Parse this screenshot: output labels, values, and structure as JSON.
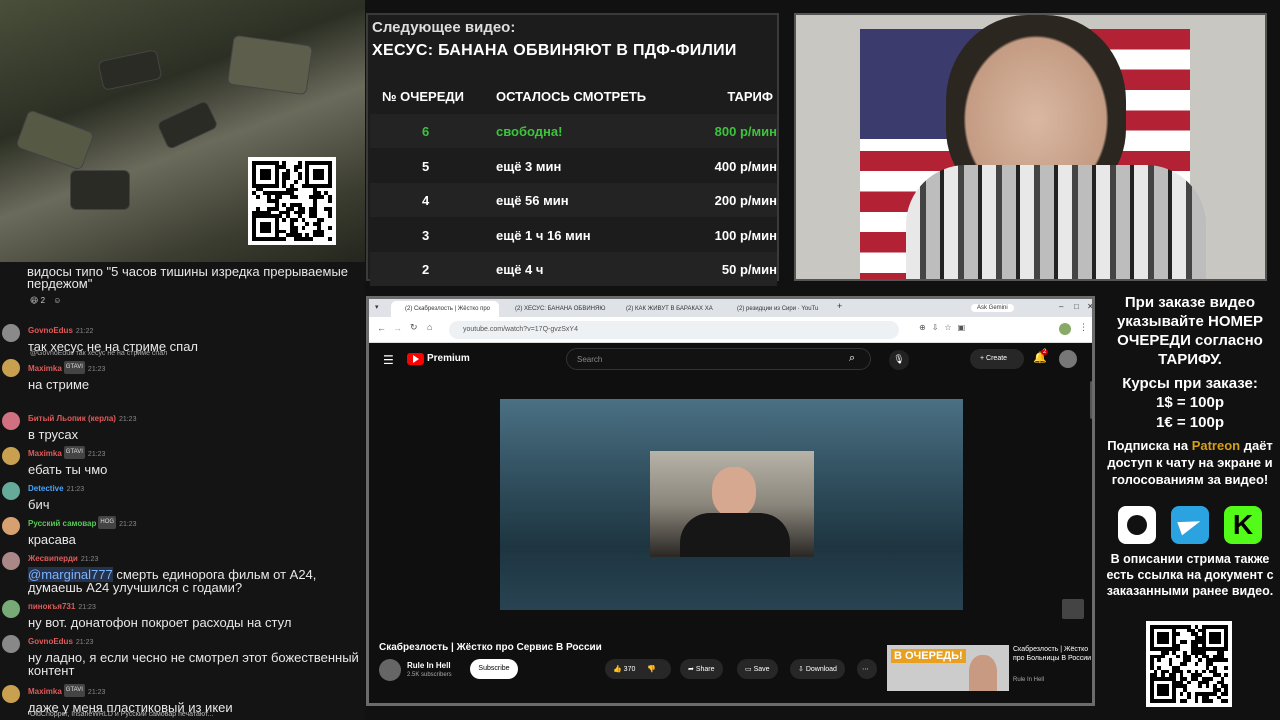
{
  "chat": {
    "top_text": "видосы типо \"5 часов тишины изредка прерываемые пердежом\"",
    "top_reactions": "2",
    "messages": [
      {
        "user": "GovnoEdus",
        "time": "21:22",
        "text": "так хесус не на стриме спал",
        "color": "#e05a5a"
      },
      {
        "reply": "@GovnoEdus так хесус не на стриме спал",
        "user": "Maximka",
        "badge": "GTAVI",
        "time": "21:23",
        "text": "на стриме",
        "color": "#e05a5a"
      },
      {
        "user": "Битый Льопик (керла)",
        "time": "21:23",
        "text": "в трусах",
        "color": "#e05a5a"
      },
      {
        "user": "Maximka",
        "badge": "GTAVI",
        "time": "21:23",
        "text": "ебать ты чмо",
        "color": "#e05a5a"
      },
      {
        "user": "Detective",
        "time": "21:23",
        "text": "бич",
        "color": "#4aa3ff"
      },
      {
        "user": "Русский самовар",
        "badge": "HOG",
        "time": "21:23",
        "text": "красава",
        "color": "#57c857"
      },
      {
        "user": "Жесвиперди",
        "time": "21:23",
        "mention": "@marginal777",
        "text": " смерть единорога фильм от A24, думаешь A24 улучшился с годами?",
        "color": "#e05a5a"
      },
      {
        "user": "пинокъя731",
        "time": "21:23",
        "text": "ну вот. донатофон покроет расходы на стул",
        "color": "#e05a5a"
      },
      {
        "user": "GovnoEdus",
        "time": "21:23",
        "text": "ну ладно, я если чесно не смотрел этот божественный контент",
        "color": "#e05a5a"
      },
      {
        "user": "Maximka",
        "badge": "GTAVI",
        "time": "21:23",
        "text": "даже у меня пластиковый из икеи",
        "color": "#e05a5a"
      }
    ],
    "typing": "OldChopper, InsaneWRLD и Русский самовар печатают..."
  },
  "queue": {
    "heading": "Следующее видео:",
    "title": "ХЕСУС: БАНАНА ОБВИНЯЮТ В ПДФ-ФИЛИИ",
    "col_num": "№ ОЧЕРЕДИ",
    "col_left": "ОСТАЛОСЬ СМОТРЕТЬ",
    "col_rate": "ТАРИФ",
    "rows": [
      {
        "num": "6",
        "left": "свободна!",
        "rate": "800 р/мин",
        "free": true
      },
      {
        "num": "5",
        "left": "ещё 3 мин",
        "rate": "400 р/мин"
      },
      {
        "num": "4",
        "left": "ещё 56 мин",
        "rate": "200 р/мин"
      },
      {
        "num": "3",
        "left": "ещё 1 ч 16 мин",
        "rate": "100 р/мин"
      },
      {
        "num": "2",
        "left": "ещё 4 ч",
        "rate": "50 р/мин"
      }
    ],
    "free_color": "#3dc43d"
  },
  "browser": {
    "tabs": [
      "(2) Скабрезлость | Жёстко про",
      "(2) ХЕСУС: БАНАНА ОБВИНЯЮ",
      "(2) КАК ЖИВУТ В БАРАКАХ ХА",
      "(2) резидции из Сири · YouTu"
    ],
    "ask": "Ask Gemini",
    "url": "youtube.com/watch?v=17Q-gvzSxY4",
    "yt_logo": "Premium",
    "search_placeholder": "Search",
    "create": "Create",
    "notif_count": "2",
    "video_title": "Скабрезлость | Жёстко про Сервис В России",
    "channel": "Rule In Hell",
    "subs": "2.5K subscribers",
    "subscribe": "Subscribe",
    "likes": "370",
    "share": "Share",
    "save": "Save",
    "download": "Download",
    "rec_thumb_text": "В ОЧЕРЕДЬ!",
    "rec_title": "Скабрезлость | Жёстко про Больницы В России",
    "rec_channel": "Rule In Hell"
  },
  "right_panel": {
    "p1": "При заказе видео указывайте НОМЕР ОЧЕРЕДИ согласно ТАРИФУ.",
    "p2": "Курсы при заказе:",
    "rate1": "1$ = 100р",
    "rate2": "1€ = 100р",
    "p3_a": "Подписка на ",
    "p3_link": "Patreon",
    "p3_b": " даёт доступ к чату на экране и голосованиям за видео!",
    "p4": "В описании стрима также есть ссылка на документ с заказанными ранее видео.",
    "link_color": "#d4a017"
  }
}
